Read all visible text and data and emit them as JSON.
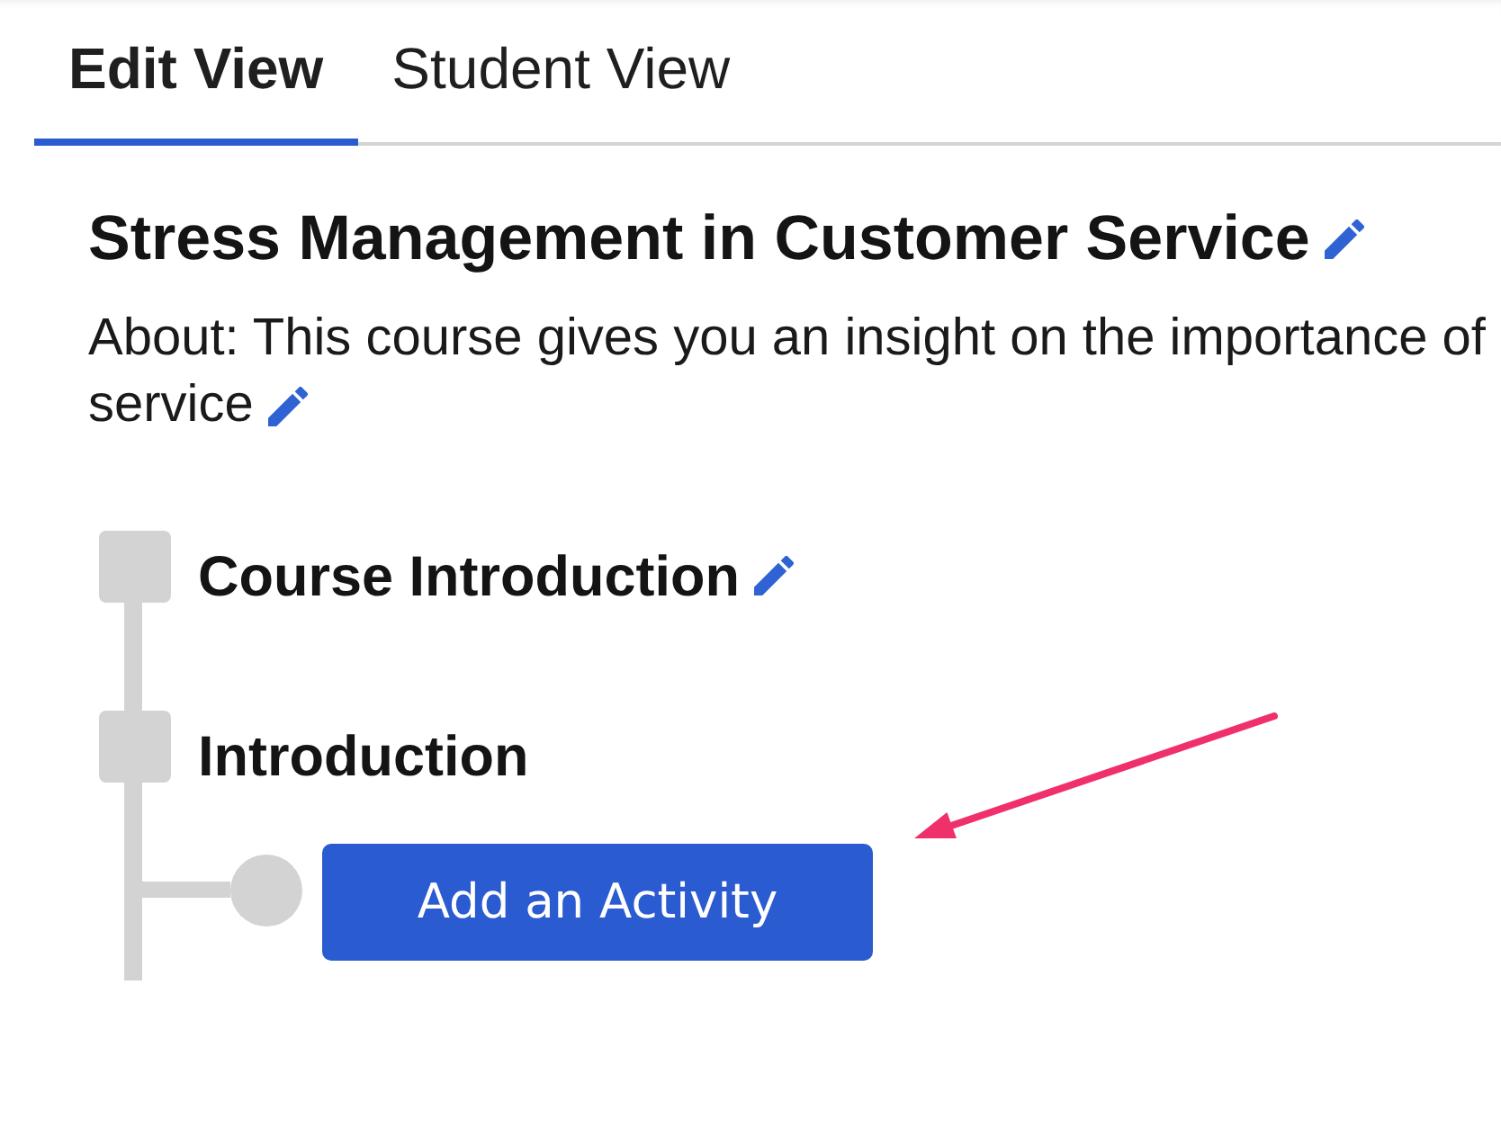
{
  "tabs": [
    {
      "label": "Edit View",
      "selected": true
    },
    {
      "label": "Student View",
      "selected": false
    }
  ],
  "course": {
    "title": "Stress Management in Customer Service",
    "title_editable": true,
    "about_lines": [
      "About: This course gives you an insight on the importance of",
      "service"
    ],
    "about_editable": true
  },
  "outline": [
    {
      "kind": "section",
      "title": "Course Introduction",
      "editable": true
    },
    {
      "kind": "section",
      "title": "Introduction",
      "editable": false
    },
    {
      "kind": "add_activity",
      "label": "Add an Activity"
    }
  ]
}
